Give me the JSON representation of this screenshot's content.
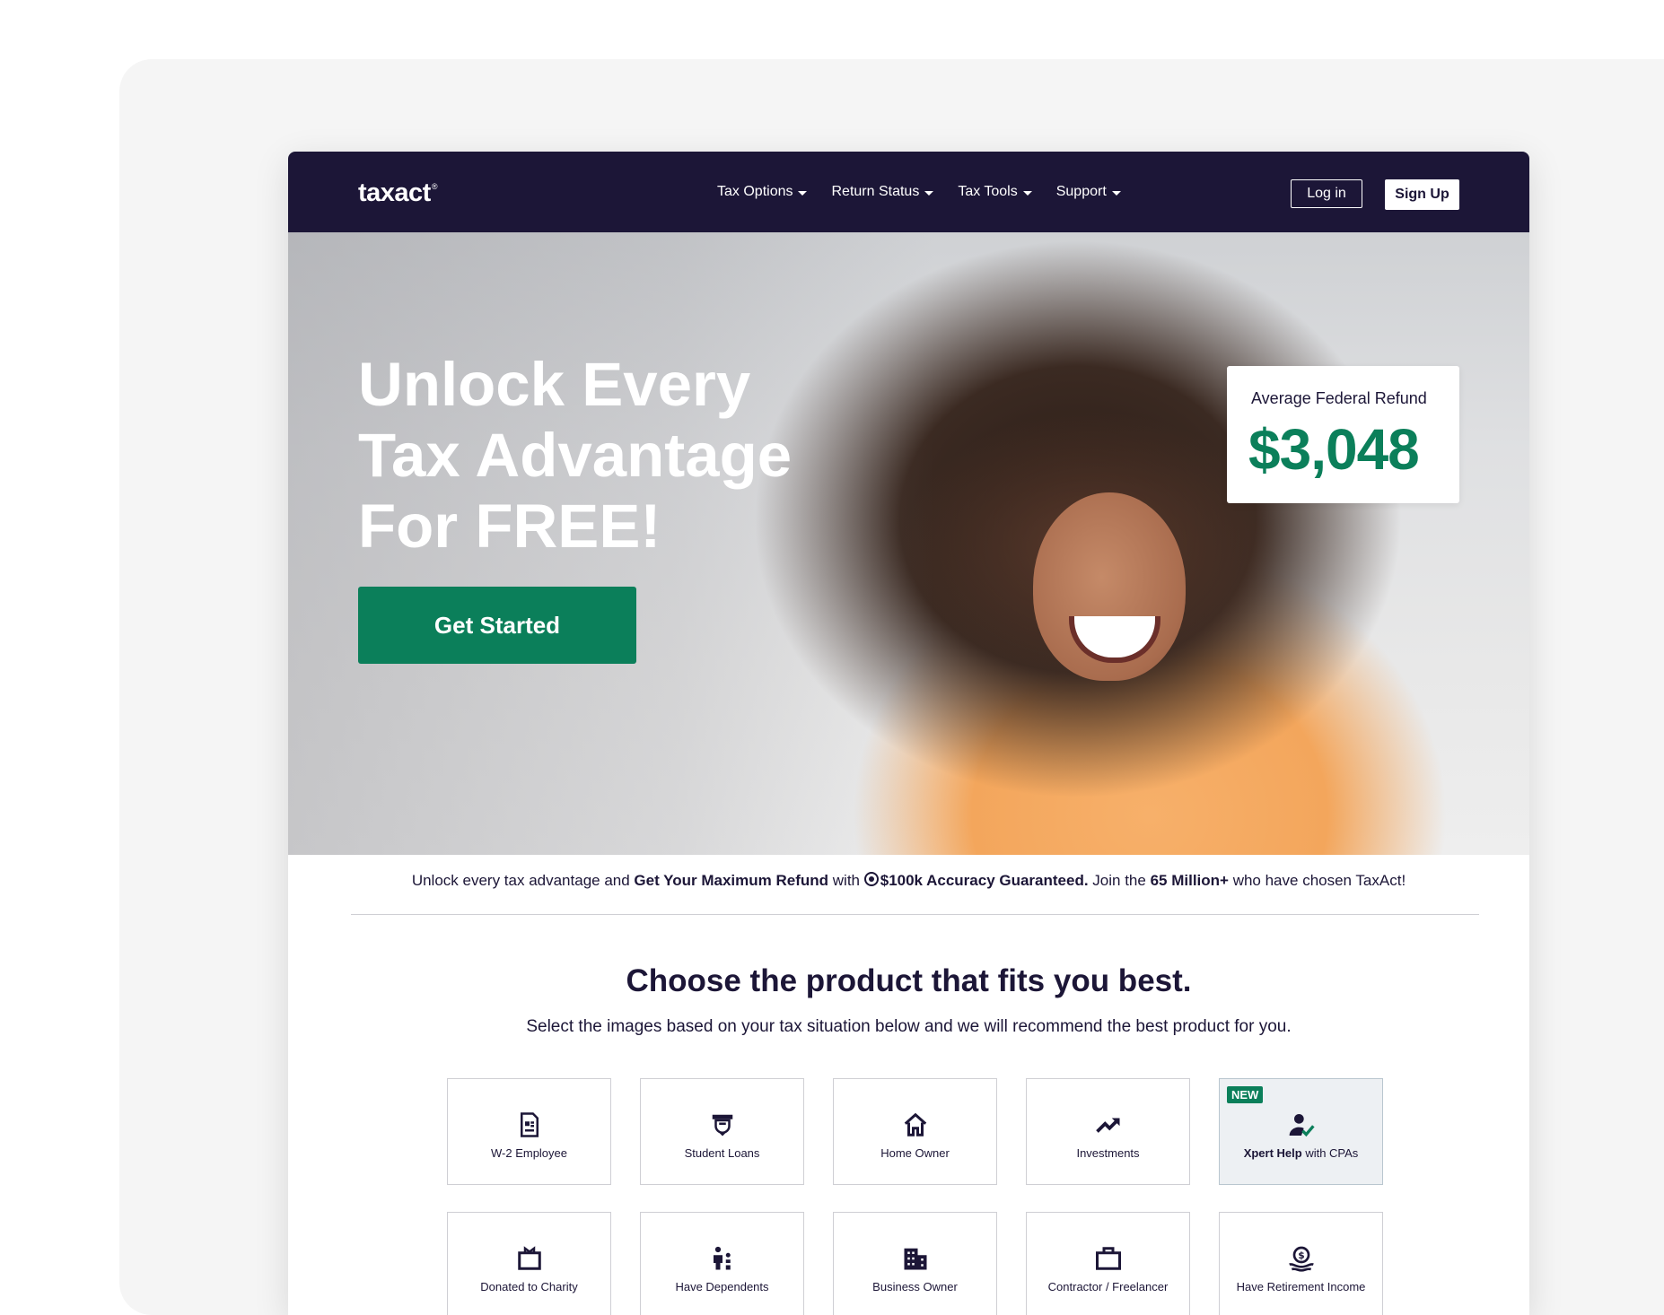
{
  "nav": {
    "logo": "taxact",
    "logo_mark": "®",
    "menu": [
      {
        "label": "Tax Options"
      },
      {
        "label": "Return Status"
      },
      {
        "label": "Tax Tools"
      },
      {
        "label": "Support"
      }
    ],
    "login_label": "Log in",
    "signup_label": "Sign Up"
  },
  "hero": {
    "title_lines": [
      "Unlock Every",
      "Tax Advantage",
      "For FREE!"
    ],
    "cta_label": "Get Started",
    "refund_label": "Average Federal Refund",
    "refund_value": "$3,048"
  },
  "strip": {
    "part1": "Unlock every tax advantage and ",
    "bold1": "Get Your Maximum Refund",
    "part2": " with ",
    "icon": "target-icon",
    "bold2": "$100k Accuracy Guaranteed.",
    "part3": " Join the ",
    "bold3": "65 Million+",
    "part4": " who have chosen TaxAct!"
  },
  "section": {
    "title": "Choose the product that fits you best.",
    "subtitle": "Select the images based on your tax situation below and we will recommend the best product for you."
  },
  "tiles": [
    {
      "label": "W-2 Employee",
      "icon": "document-icon"
    },
    {
      "label": "Student Loans",
      "icon": "graduation-cap-icon"
    },
    {
      "label": "Home Owner",
      "icon": "home-icon"
    },
    {
      "label": "Investments",
      "icon": "trending-up-icon"
    },
    {
      "label_bold": "Xpert Help",
      "label_rest": " with CPAs",
      "icon": "person-check-icon",
      "badge": "NEW"
    },
    {
      "label": "Donated to Charity",
      "icon": "gift-box-icon"
    },
    {
      "label": "Have Dependents",
      "icon": "family-icon"
    },
    {
      "label": "Business Owner",
      "icon": "building-icon"
    },
    {
      "label": "Contractor / Freelancer",
      "icon": "briefcase-icon"
    },
    {
      "label": "Have Retirement Income",
      "icon": "money-hand-icon"
    }
  ],
  "colors": {
    "nav_bg": "#1c1637",
    "brand_green": "#0b7f5a",
    "text_dark": "#1c1637"
  }
}
